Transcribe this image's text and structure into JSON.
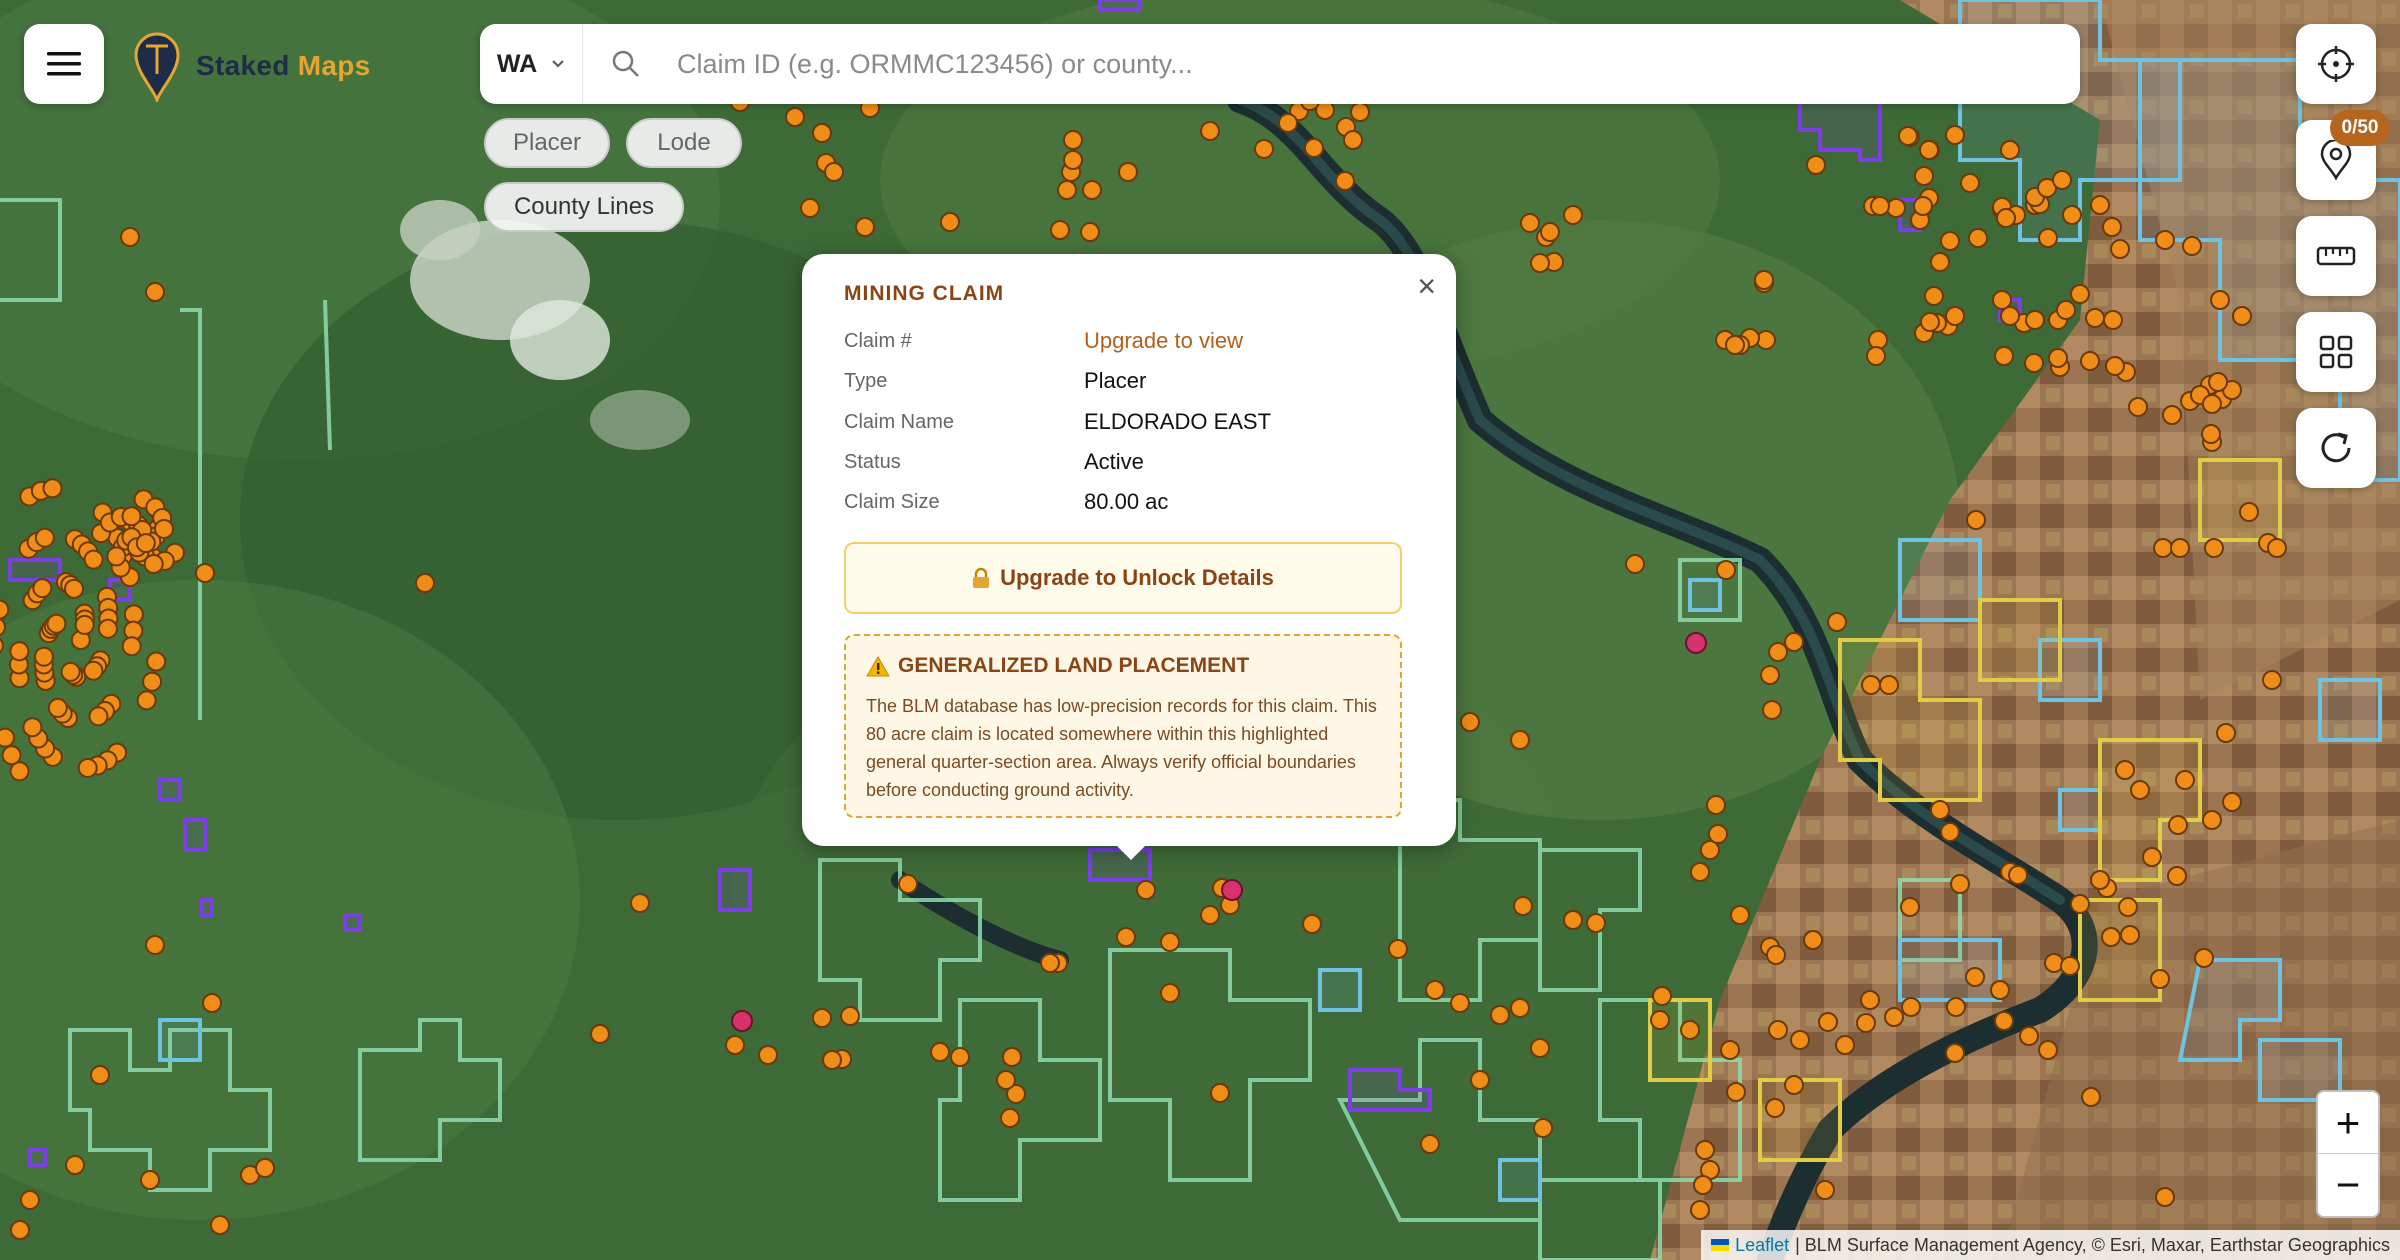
{
  "app": {
    "brand_part1": "Staked",
    "brand_part2": "Maps"
  },
  "search": {
    "state": "WA",
    "placeholder": "Claim ID (e.g. ORMMC123456) or county..."
  },
  "filters": [
    {
      "label": "Placer"
    },
    {
      "label": "Lode"
    },
    {
      "label": "County Lines"
    }
  ],
  "side_controls": {
    "saved_badge": "0/50"
  },
  "zoom": {
    "in": "+",
    "out": "−"
  },
  "attribution": {
    "leaflet": "Leaflet",
    "rest": "| BLM Surface Management Agency, © Esri, Maxar, Earthstar Geographics"
  },
  "popup": {
    "title": "MINING CLAIM",
    "close": "×",
    "fields": [
      {
        "label": "Claim #",
        "value": "Upgrade to view"
      },
      {
        "label": "Type",
        "value": "Placer"
      },
      {
        "label": "Claim Name",
        "value": "ELDORADO EAST"
      },
      {
        "label": "Status",
        "value": "Active"
      },
      {
        "label": "Claim Size",
        "value": "80.00 ac"
      }
    ],
    "upgrade_button": "Upgrade to Unlock Details",
    "warning_title": "GENERALIZED LAND PLACEMENT",
    "warning_body": "The BLM database has low-precision records for this claim. This 80 acre claim is located somewhere within this highlighted general quarter-section area. Always verify official boundaries before conducting ground activity."
  },
  "colors": {
    "claim_marker": "#f08c18",
    "selected_marker": "#d6336c",
    "lode_outline": "#7b3fe4",
    "blm_outline": "#8fdcb0",
    "brand_accent": "#e4a532"
  }
}
